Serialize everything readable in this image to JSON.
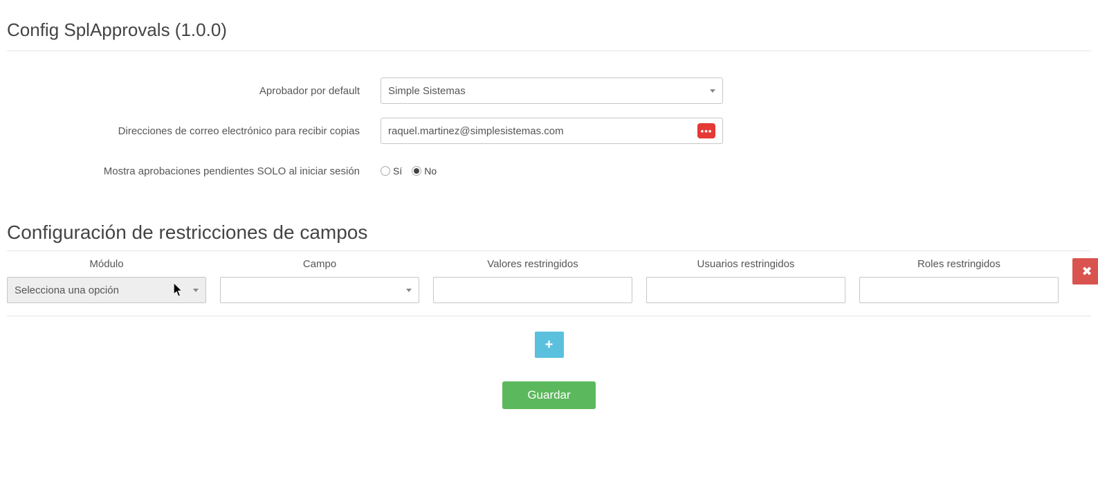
{
  "page_title": "Config SplApprovals (1.0.0)",
  "form": {
    "approver_label": "Aprobador por default",
    "approver_value": "Simple Sistemas",
    "emails_label": "Direcciones de correo electrónico para recibir copias",
    "emails_value": "raquel.martinez@simplesistemas.com",
    "emails_overflow": "•••",
    "pending_label": "Mostra aprobaciones pendientes SOLO al iniciar sesión",
    "radio_yes": "Sí",
    "radio_no": "No",
    "radio_selected": "No"
  },
  "section_title": "Configuración de restricciones de campos",
  "restrictions": {
    "headers": {
      "module": "Módulo",
      "field": "Campo",
      "values": "Valores restringidos",
      "users": "Usuarios restringidos",
      "roles": "Roles restringidos"
    },
    "row": {
      "module_placeholder": "Selecciona una opción",
      "field_value": "",
      "values_value": "",
      "users_value": "",
      "roles_value": ""
    }
  },
  "buttons": {
    "save": "Guardar"
  }
}
